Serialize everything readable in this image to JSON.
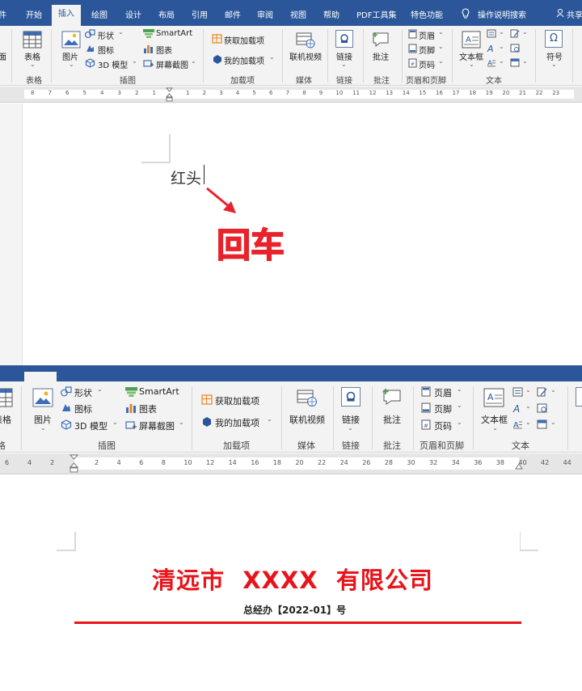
{
  "top": {
    "tabs": [
      "件",
      "开始",
      "插入",
      "绘图",
      "设计",
      "布局",
      "引用",
      "邮件",
      "审阅",
      "视图",
      "帮助",
      "PDF工具集",
      "特色功能",
      "操作说明搜索",
      "共享"
    ],
    "ribbon": {
      "left_label": "面",
      "table": "表格",
      "picture": "图片",
      "shapes": "形状",
      "icons": "图标",
      "model3d": "3D 模型",
      "smartart": "SmartArt",
      "chart": "图表",
      "screenshot": "屏幕截图",
      "get_addins": "获取加载项",
      "my_addins": "我的加载项",
      "online_video": "联机视频",
      "link": "链接",
      "comment": "批注",
      "header": "页眉",
      "footer": "页脚",
      "page_number": "页码",
      "textbox": "文本框",
      "symbol": "符号",
      "symbol_glyph": "Ω"
    },
    "groups": [
      "表格",
      "插图",
      "加载项",
      "媒体",
      "链接",
      "批注",
      "页眉和页脚",
      "文本"
    ],
    "ruler_left": [
      "8",
      "7",
      "6",
      "5",
      "4",
      "3",
      "2",
      "1"
    ],
    "ruler_right": [
      "1",
      "2",
      "3",
      "4",
      "5",
      "6",
      "7",
      "8",
      "9",
      "10",
      "11",
      "12",
      "13",
      "14",
      "15",
      "16",
      "17",
      "18",
      "19",
      "20",
      "21",
      "22",
      "23"
    ],
    "doc_text": "红头",
    "annotation": "回车"
  },
  "bottom": {
    "ribbon": {
      "table": "表格",
      "table_left": "格",
      "picture": "图片",
      "shapes": "形状",
      "icons": "图标",
      "model3d": "3D 模型",
      "smartart": "SmartArt",
      "chart": "图表",
      "screenshot": "屏幕截图",
      "get_addins": "获取加载项",
      "my_addins": "我的加载项",
      "online_video": "联机视频",
      "link": "链接",
      "comment": "批注",
      "header": "页眉",
      "footer": "页脚",
      "page_number": "页码",
      "textbox": "文本框"
    },
    "groups": [
      "格",
      "插图",
      "加载项",
      "媒体",
      "链接",
      "批注",
      "页眉和页脚",
      "文本"
    ],
    "ruler_left": [
      "6",
      "4",
      "2"
    ],
    "ruler_right": [
      "2",
      "4",
      "6",
      "8",
      "10",
      "12",
      "14",
      "16",
      "18",
      "20",
      "22",
      "24",
      "26",
      "28",
      "30",
      "32",
      "34",
      "36",
      "38",
      "40",
      "42",
      "44"
    ],
    "company_title": "清远市  XXXX  有限公司",
    "doc_number": "总经办【2022-01】号"
  },
  "colors": {
    "titlebar": "#2b579a",
    "ribbon_bg": "#f3f3f3",
    "red_heading": "#e8141b",
    "annotation_red": "#e8232b"
  }
}
